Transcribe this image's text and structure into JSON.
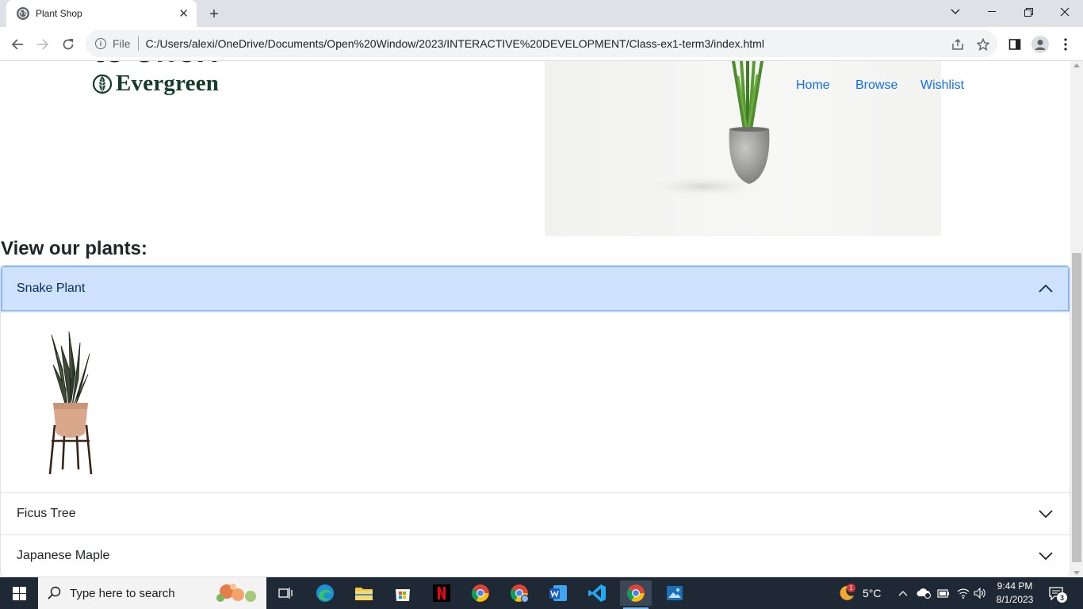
{
  "browser": {
    "tab_title": "Plant Shop",
    "omnibox_scheme": "File",
    "url": "C:/Users/alexi/OneDrive/Documents/Open%20Window/2023/INTERACTIVE%20DEVELOPMENT/Class-ex1-term3/index.html"
  },
  "page": {
    "cut_heading": "to offer!",
    "brand": "Evergreen",
    "nav": [
      "Home",
      "Browse",
      "Wishlist"
    ],
    "section_title": "View our plants:",
    "accordion": [
      {
        "label": "Snake Plant",
        "expanded": true
      },
      {
        "label": "Ficus Tree",
        "expanded": false
      },
      {
        "label": "Japanese Maple",
        "expanded": false
      }
    ]
  },
  "taskbar": {
    "search_placeholder": "Type here to search",
    "weather": "5°C",
    "weather_badge": "1",
    "time": "9:44 PM",
    "date": "8/1/2023",
    "notification_count": "3"
  },
  "colors": {
    "accent_link": "#0d6efd",
    "accordion_active_bg": "#cfe2ff",
    "brand_green": "#123d2a",
    "taskbar": "#1f2835"
  }
}
